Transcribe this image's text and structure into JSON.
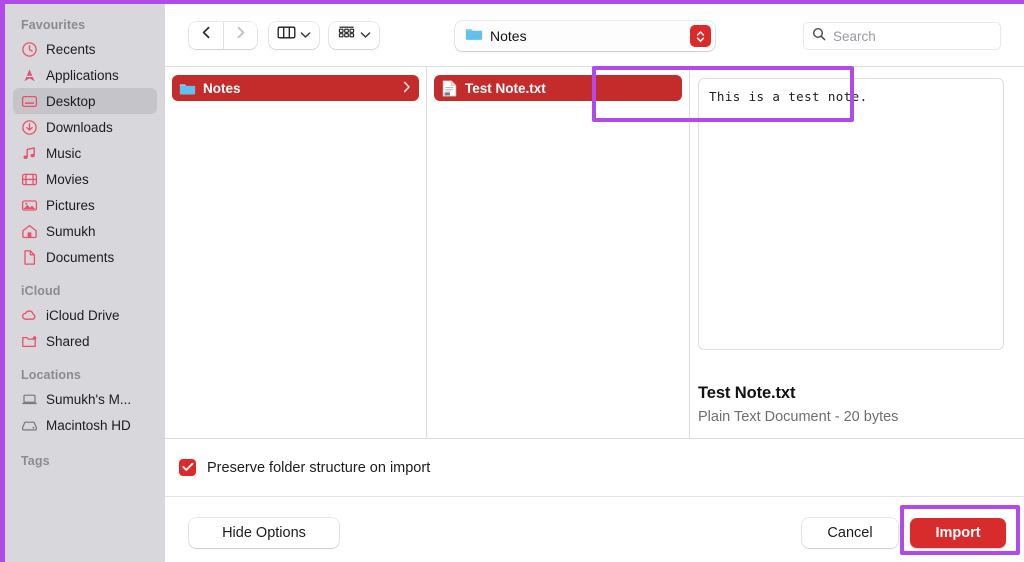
{
  "sidebar": {
    "sections": [
      {
        "header": "Favourites",
        "items": [
          {
            "label": "Recents",
            "icon": "clock-icon",
            "selected": false
          },
          {
            "label": "Applications",
            "icon": "applications-icon",
            "selected": false
          },
          {
            "label": "Desktop",
            "icon": "desktop-icon",
            "selected": true
          },
          {
            "label": "Downloads",
            "icon": "download-icon",
            "selected": false
          },
          {
            "label": "Music",
            "icon": "music-note-icon",
            "selected": false
          },
          {
            "label": "Movies",
            "icon": "film-icon",
            "selected": false
          },
          {
            "label": "Pictures",
            "icon": "photo-icon",
            "selected": false
          },
          {
            "label": "Sumukh",
            "icon": "home-icon",
            "selected": false
          },
          {
            "label": "Documents",
            "icon": "document-icon",
            "selected": false
          }
        ]
      },
      {
        "header": "iCloud",
        "items": [
          {
            "label": "iCloud Drive",
            "icon": "cloud-icon",
            "selected": false
          },
          {
            "label": "Shared",
            "icon": "shared-folder-icon",
            "selected": false
          }
        ]
      },
      {
        "header": "Locations",
        "items": [
          {
            "label": "Sumukh's M...",
            "icon": "laptop-icon",
            "selected": false
          },
          {
            "label": "Macintosh HD",
            "icon": "harddisk-icon",
            "selected": false
          }
        ]
      },
      {
        "header": "Tags",
        "items": []
      }
    ]
  },
  "toolbar": {
    "back_icon": "chevron-left-icon",
    "forward_icon": "chevron-right-icon",
    "view_mode_icon": "column-view-icon",
    "group_by_icon": "group-items-icon",
    "path": {
      "label": "Notes",
      "icon": "folder-icon"
    },
    "search": {
      "placeholder": "Search",
      "value": "",
      "icon": "search-icon"
    }
  },
  "browser": {
    "column1": [
      {
        "label": "Notes",
        "icon": "folder-icon",
        "selected": true,
        "has_children": true
      }
    ],
    "column2": [
      {
        "label": "Test Note.txt",
        "icon": "text-file-icon",
        "selected": true,
        "has_children": false
      }
    ]
  },
  "preview": {
    "content": "This is a test note.",
    "name": "Test Note.txt",
    "meta": "Plain Text Document - 20 bytes"
  },
  "options": {
    "checkbox_label": "Preserve folder structure on import",
    "checkbox_checked": true,
    "check_icon": "checkmark-icon"
  },
  "footer": {
    "hide_options_label": "Hide Options",
    "cancel_label": "Cancel",
    "import_label": "Import"
  },
  "colors": {
    "selection_red": "#c42b2b",
    "accent_red": "#d82b2b",
    "annotation_purple": "#b04ae8",
    "sidebar_bg": "#d8d8dc",
    "sidebar_icon": "#e8516a"
  }
}
